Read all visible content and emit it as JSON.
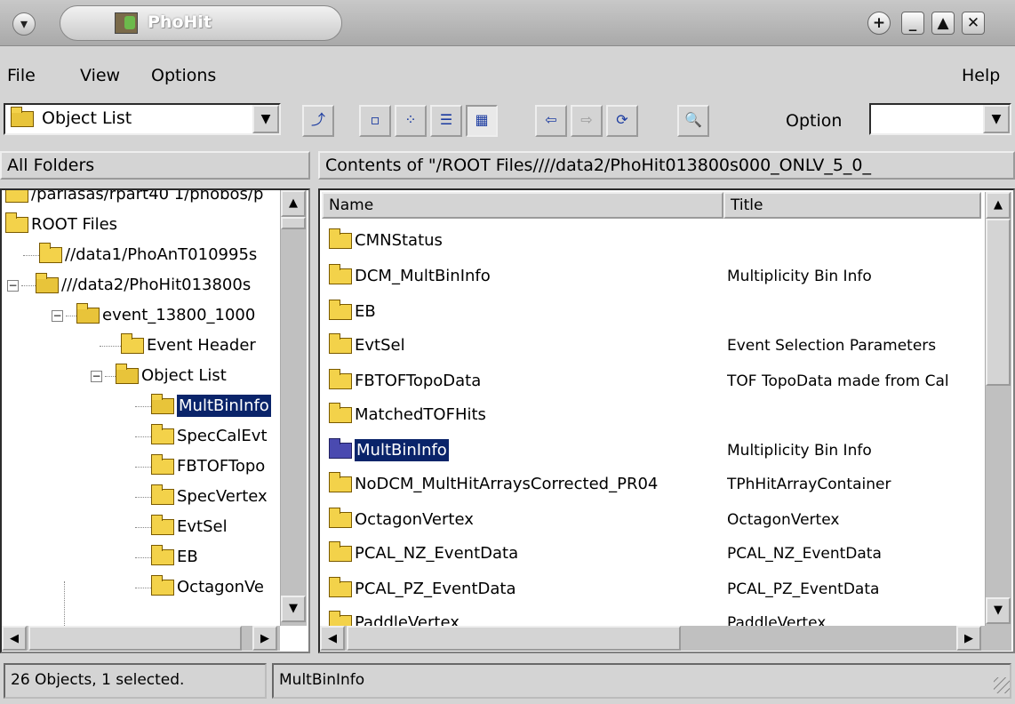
{
  "window": {
    "title": "PhoHit",
    "menu_icon": "chevron-down-icon",
    "controls": [
      "plus-icon",
      "minimize-icon",
      "maximize-icon",
      "close-icon"
    ]
  },
  "menu": {
    "file": "File",
    "view": "View",
    "options": "Options",
    "help": "Help"
  },
  "toolbar": {
    "location": "Object List",
    "option_label": "Option",
    "option_value": ""
  },
  "left_pane": {
    "header": "All Folders",
    "items": [
      {
        "label": "/parlasas/rpart40 1/phobos/p",
        "expander": ""
      },
      {
        "label": "ROOT Files",
        "expander": ""
      },
      {
        "label": "//data1/PhoAnT010995s",
        "expander": ""
      },
      {
        "label": "///data2/PhoHit013800s",
        "expander": "−"
      },
      {
        "label": "event_13800_1000",
        "expander": "−"
      },
      {
        "label": "Event Header",
        "expander": ""
      },
      {
        "label": "Object List",
        "expander": "−"
      },
      {
        "label": "MultBinInfo",
        "expander": ""
      },
      {
        "label": "SpecCalEvt",
        "expander": ""
      },
      {
        "label": "FBTOFTopo",
        "expander": ""
      },
      {
        "label": "SpecVertex",
        "expander": ""
      },
      {
        "label": "EvtSel",
        "expander": ""
      },
      {
        "label": "EB",
        "expander": ""
      },
      {
        "label": "OctagonVe",
        "expander": ""
      }
    ]
  },
  "right_pane": {
    "header": "Contents of \"/ROOT Files////data2/PhoHit013800s000_ONLV_5_0_",
    "columns": {
      "name": "Name",
      "title": "Title"
    },
    "rows": [
      {
        "name": "CMNStatus",
        "title": ""
      },
      {
        "name": "DCM_MultBinInfo",
        "title": "Multiplicity Bin Info"
      },
      {
        "name": "EB",
        "title": ""
      },
      {
        "name": "EvtSel",
        "title": "Event Selection Parameters"
      },
      {
        "name": "FBTOFTopoData",
        "title": "TOF TopoData made from Cal"
      },
      {
        "name": "MatchedTOFHits",
        "title": ""
      },
      {
        "name": "MultBinInfo",
        "title": "Multiplicity Bin Info"
      },
      {
        "name": "NoDCM_MultHitArraysCorrected_PR04",
        "title": "TPhHitArrayContainer"
      },
      {
        "name": "OctagonVertex",
        "title": "OctagonVertex"
      },
      {
        "name": "PCAL_NZ_EventData",
        "title": "PCAL_NZ_EventData"
      },
      {
        "name": "PCAL_PZ_EventData",
        "title": "PCAL_PZ_EventData"
      },
      {
        "name": "PaddleVertex",
        "title": "PaddleVertex"
      }
    ]
  },
  "status": {
    "count": "26 Objects, 1 selected.",
    "selection": "MultBinInfo"
  }
}
